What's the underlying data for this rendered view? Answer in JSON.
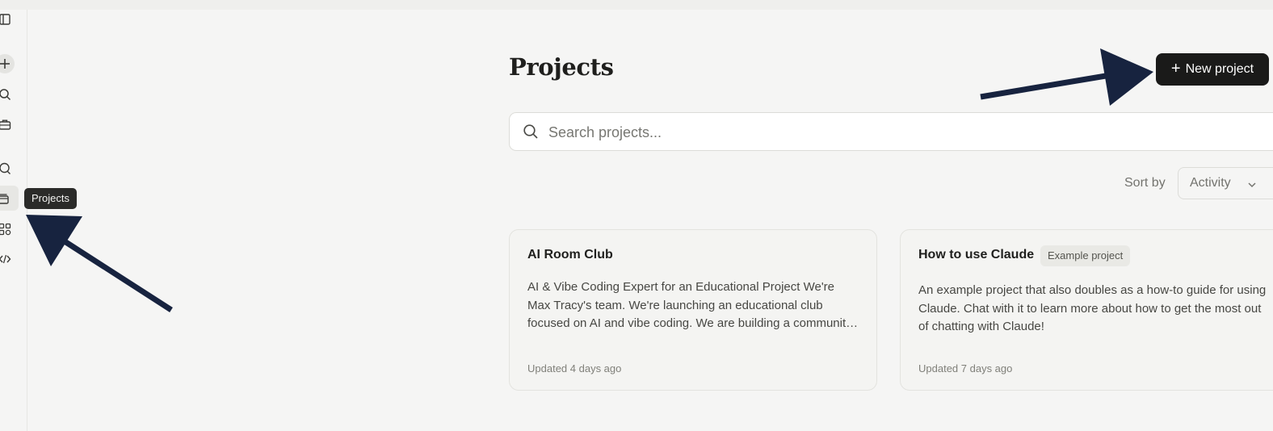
{
  "sidebar": {
    "icons": [
      "sidebar-toggle-icon",
      "plus-icon",
      "search-icon",
      "briefcase-icon",
      "chat-icon",
      "folder-stack-icon",
      "apps-grid-icon",
      "code-icon"
    ],
    "tooltip": "Projects"
  },
  "header": {
    "title": "Projects",
    "new_button_label": "New project"
  },
  "search": {
    "placeholder": "Search projects..."
  },
  "sort": {
    "label": "Sort by",
    "value": "Activity"
  },
  "projects": [
    {
      "name": "AI Room Club",
      "description": "AI & Vibe Coding Expert for an Educational Project We're Max Tracy's team. We're launching an educational club focused on AI and vibe coding. We are building a community for learners",
      "updated": "Updated 4 days ago"
    },
    {
      "name": "How to use Claude",
      "badge": "Example project",
      "description": "An example project that also doubles as a how-to guide for using Claude. Chat with it to learn more about how to get the most out of chatting with Claude!",
      "updated": "Updated 7 days ago"
    }
  ],
  "colors": {
    "background": "#f5f5f4",
    "primary_button": "#1a1a19",
    "annotation_arrow": "#17233f"
  }
}
